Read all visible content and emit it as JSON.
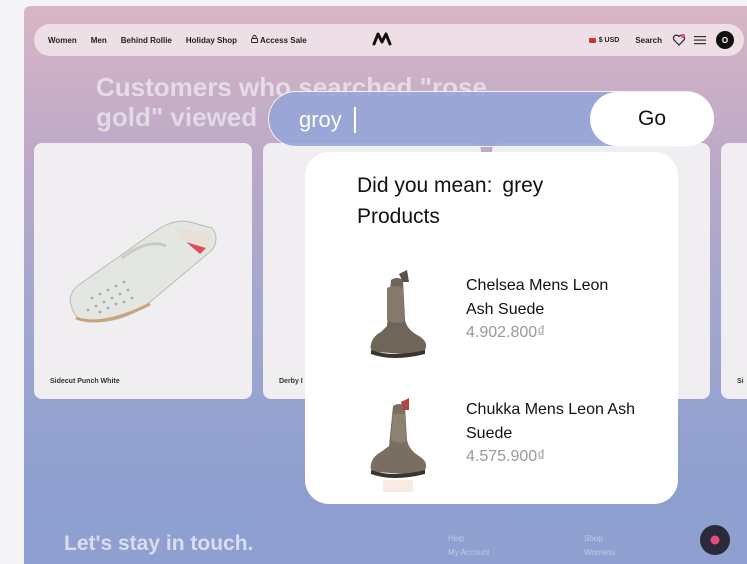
{
  "nav": {
    "links": [
      "Women",
      "Men",
      "Behind Rollie",
      "Holiday Shop",
      "Access Sale"
    ],
    "currency": "$ USD",
    "search_label": "Search",
    "avatar_initial": "O"
  },
  "heading": "Customers who searched \"rose gold\" viewed",
  "cards": [
    {
      "caption": "Sidecut Punch White"
    },
    {
      "caption": "Derby I"
    },
    {
      "caption": ""
    },
    {
      "caption": "Si"
    }
  ],
  "search": {
    "value": "groy",
    "go_label": "Go"
  },
  "suggestions": {
    "did_you_mean_label": "Did you mean:",
    "suggested_term": "grey",
    "products_label": "Products",
    "results": [
      {
        "name": "Chelsea Mens Leon Ash Suede",
        "price": "4.902.800₫"
      },
      {
        "name": "Chukka Mens Leon Ash Suede",
        "price": "4.575.900₫"
      }
    ]
  },
  "footer": {
    "title": "Let's stay in touch.",
    "col1": [
      "Help",
      "My Account"
    ],
    "col2": [
      "Shop",
      "Womens"
    ]
  },
  "colors": {
    "accent": "#8e9fcf",
    "go_button": "#ffffff",
    "text": "#111111"
  }
}
